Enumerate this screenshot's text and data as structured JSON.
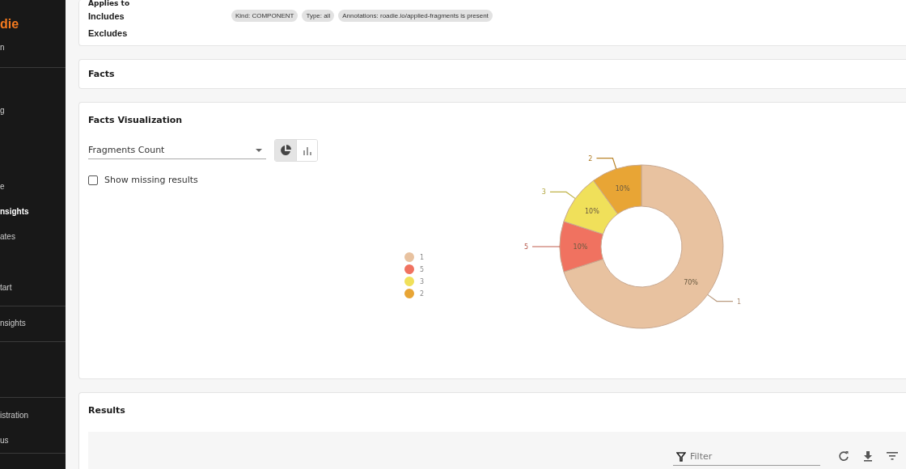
{
  "sidebar": {
    "logo": "die",
    "sections": [
      [
        {
          "label": "n",
          "selected": false
        }
      ],
      [
        {
          "label": "g",
          "selected": false
        },
        {
          "label": "e",
          "selected": false
        },
        {
          "label": "nsights",
          "selected": true
        },
        {
          "label": "ates",
          "selected": false
        },
        {
          "label": "tart",
          "selected": false
        }
      ],
      [
        {
          "label": "nsights",
          "selected": false
        }
      ],
      [
        {
          "label": "istration",
          "selected": false
        },
        {
          "label": "us",
          "selected": false
        }
      ]
    ]
  },
  "applies_to": {
    "title": "Applies to",
    "includes_label": "Includes",
    "excludes_label": "Excludes",
    "includes": [
      "Kind: COMPONENT",
      "Type: all",
      "Annotations: roadie.io/applied-fragments is present"
    ]
  },
  "facts": {
    "title": "Facts"
  },
  "visualization": {
    "title": "Facts Visualization",
    "select": {
      "value": "Fragments Count"
    },
    "view_toggle": [
      {
        "kind": "pie",
        "selected": true
      },
      {
        "kind": "bar",
        "selected": false
      }
    ],
    "show_missing": {
      "label": "Show missing results",
      "checked": false
    },
    "legend": [
      {
        "label": "1",
        "color": "#e8c2a0"
      },
      {
        "label": "5",
        "color": "#f07260"
      },
      {
        "label": "3",
        "color": "#f0e05a"
      },
      {
        "label": "2",
        "color": "#e8a535"
      }
    ],
    "chart_data": {
      "type": "donut",
      "categories": [
        "1",
        "5",
        "3",
        "2"
      ],
      "values": [
        70,
        10,
        10,
        10
      ],
      "value_labels": [
        "70%",
        "10%",
        "10%",
        "10%"
      ]
    }
  },
  "results": {
    "title": "Results",
    "filter": {
      "placeholder": "Filter"
    }
  }
}
